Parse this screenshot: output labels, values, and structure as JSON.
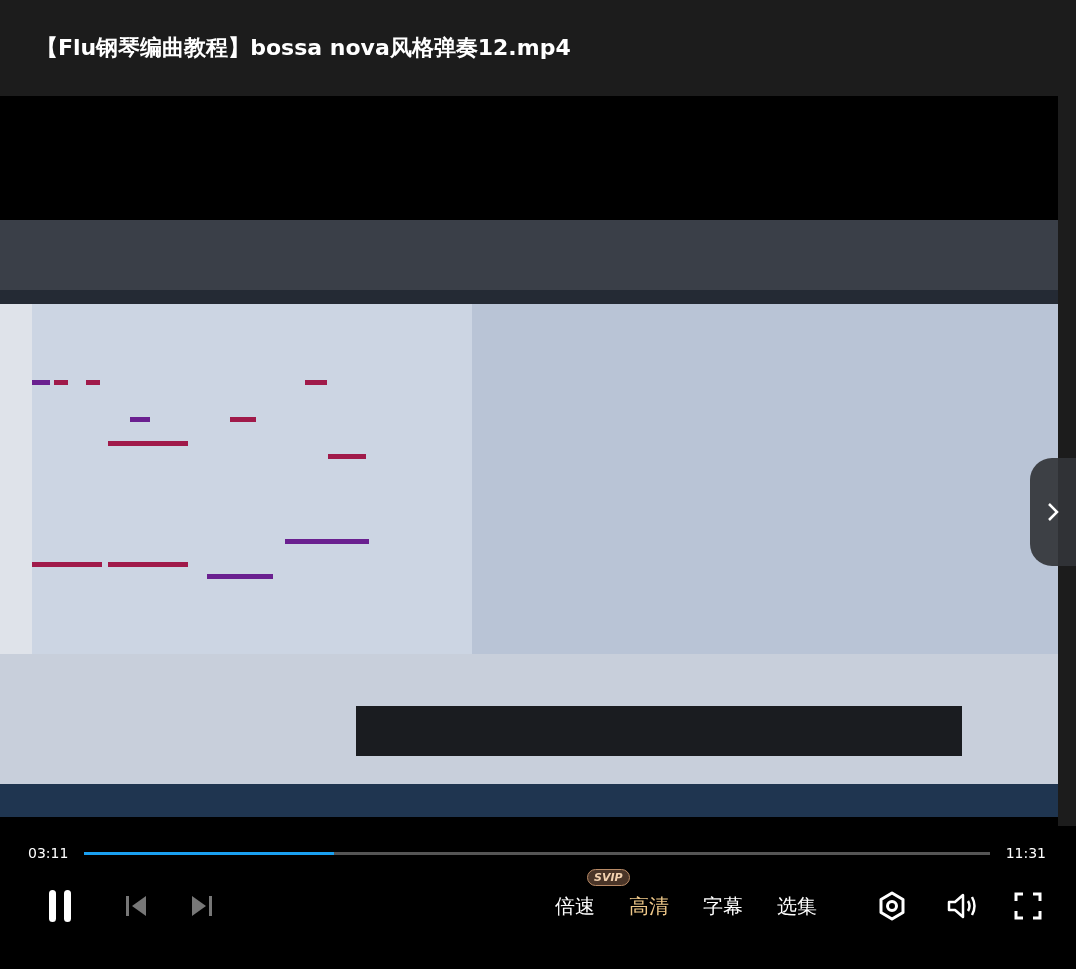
{
  "title": "【Flu钢琴编曲教程】bossa nova风格弹奏12.mp4",
  "progress": {
    "elapsed": "03:11",
    "total": "11:31",
    "level": 0.276
  },
  "playback": {
    "playing": true
  },
  "options": [
    {
      "label": "倍速",
      "badge": "SVIP",
      "selected": false
    },
    {
      "label": "高清",
      "selected": true
    },
    {
      "label": "字幕",
      "selected": false
    },
    {
      "label": "选集",
      "selected": false
    }
  ]
}
